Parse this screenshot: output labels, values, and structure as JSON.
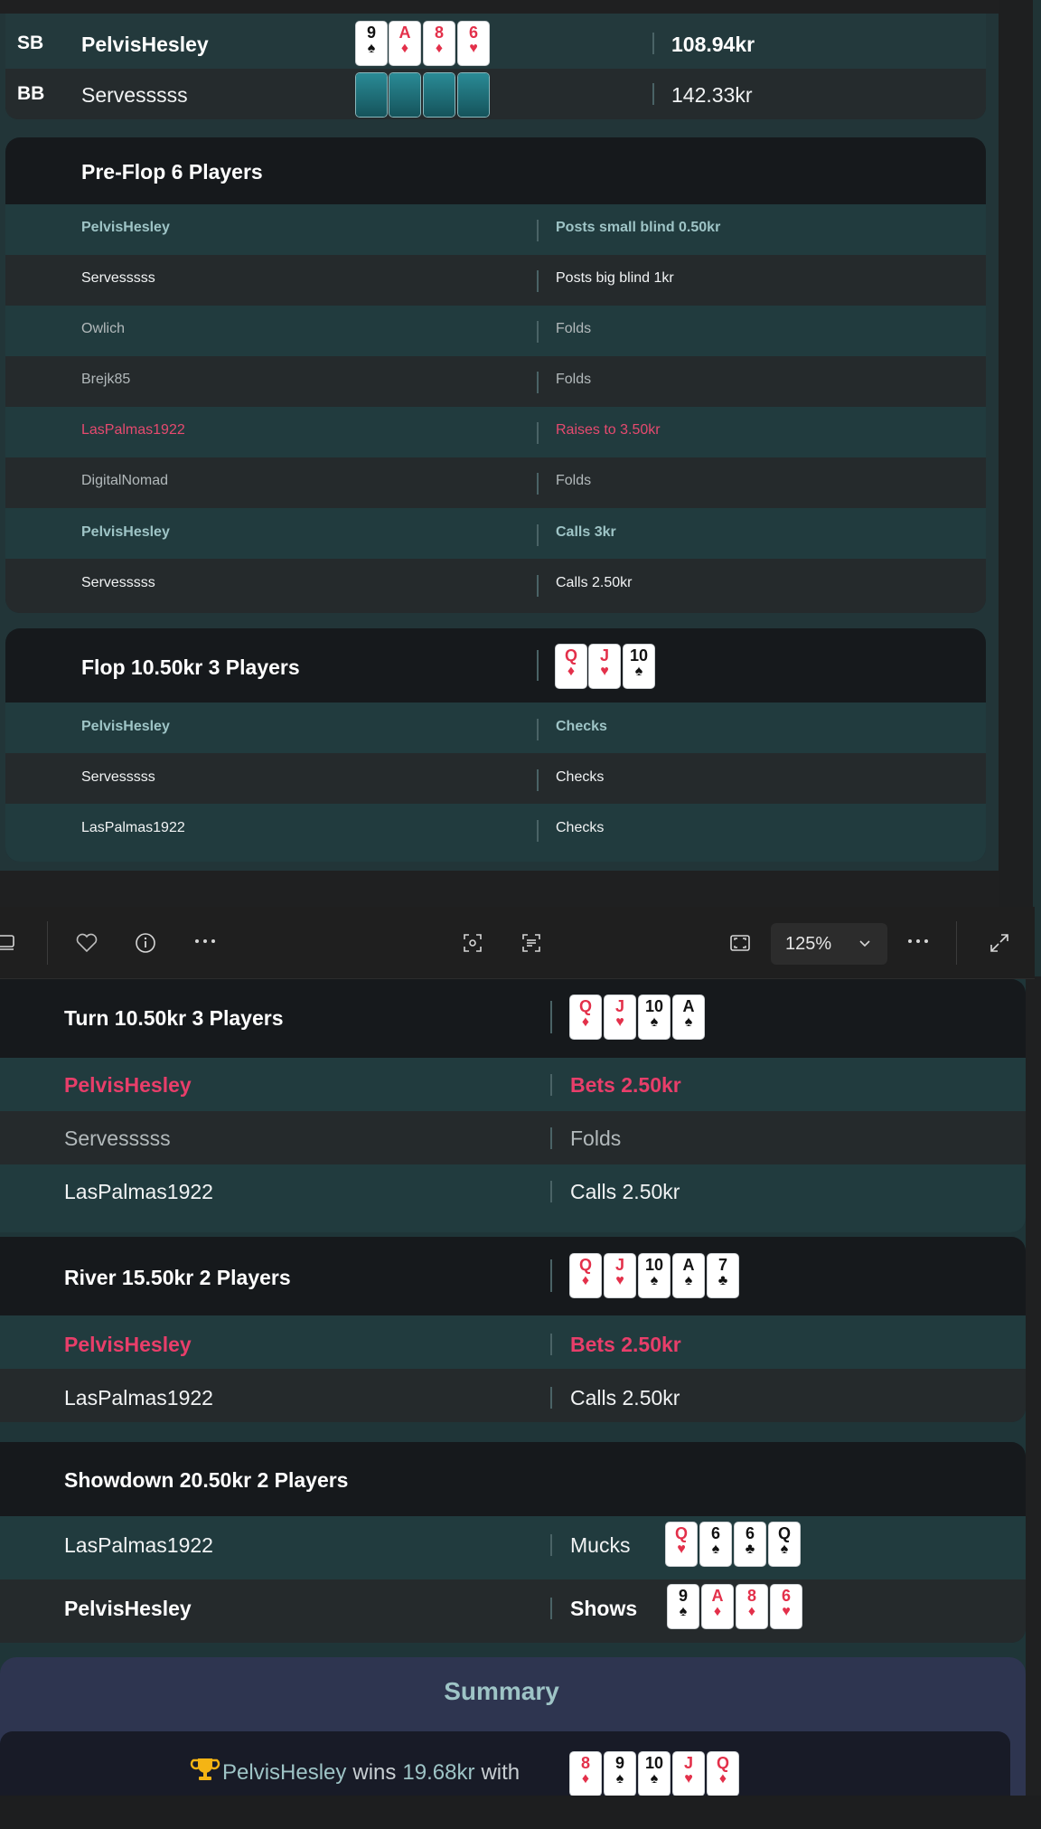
{
  "seats": [
    {
      "pos": "SB",
      "name": "PelvisHesley",
      "cards": [
        {
          "rank": "9",
          "suit": "♠"
        },
        {
          "rank": "A",
          "suit": "♦"
        },
        {
          "rank": "8",
          "suit": "♦"
        },
        {
          "rank": "6",
          "suit": "♥"
        }
      ],
      "stack": "108.94kr"
    },
    {
      "pos": "BB",
      "name": "Servesssss",
      "stack": "142.33kr"
    }
  ],
  "preflop": {
    "title": "Pre-Flop  6 Players",
    "actions": [
      {
        "name": "PelvisHesley",
        "action": "Posts small blind 0.50kr"
      },
      {
        "name": "Servesssss",
        "action": "Posts big blind 1kr"
      },
      {
        "name": "Owlich",
        "action": "Folds"
      },
      {
        "name": "Brejk85",
        "action": "Folds"
      },
      {
        "name": "LasPalmas1922",
        "action": "Raises to 3.50kr"
      },
      {
        "name": "DigitalNomad",
        "action": "Folds"
      },
      {
        "name": "PelvisHesley",
        "action": "Calls 3kr"
      },
      {
        "name": "Servesssss",
        "action": "Calls 2.50kr"
      }
    ]
  },
  "flop": {
    "title": "Flop  10.50kr  3 Players",
    "board": [
      {
        "rank": "Q",
        "suit": "♦"
      },
      {
        "rank": "J",
        "suit": "♥"
      },
      {
        "rank": "10",
        "suit": "♠"
      }
    ],
    "actions": [
      {
        "name": "PelvisHesley",
        "action": "Checks"
      },
      {
        "name": "Servesssss",
        "action": "Checks"
      },
      {
        "name": "LasPalmas1922",
        "action": "Checks"
      }
    ]
  },
  "toolbar": {
    "zoom": "125%",
    "icons": [
      "filmstrip-icon",
      "heart-icon",
      "info-icon",
      "more-icon",
      "visual-search-icon",
      "text-scan-icon",
      "fit-icon",
      "chevron-down-icon",
      "more-icon",
      "expand-icon"
    ]
  },
  "turn": {
    "title": "Turn  10.50kr  3 Players",
    "board": [
      {
        "rank": "Q",
        "suit": "♦"
      },
      {
        "rank": "J",
        "suit": "♥"
      },
      {
        "rank": "10",
        "suit": "♠"
      },
      {
        "rank": "A",
        "suit": "♠"
      }
    ],
    "actions": [
      {
        "name": "PelvisHesley",
        "action": "Bets 2.50kr"
      },
      {
        "name": "Servesssss",
        "action": "Folds"
      },
      {
        "name": "LasPalmas1922",
        "action": "Calls 2.50kr"
      }
    ]
  },
  "river": {
    "title": "River  15.50kr  2 Players",
    "board": [
      {
        "rank": "Q",
        "suit": "♦"
      },
      {
        "rank": "J",
        "suit": "♥"
      },
      {
        "rank": "10",
        "suit": "♠"
      },
      {
        "rank": "A",
        "suit": "♠"
      },
      {
        "rank": "7",
        "suit": "♣"
      }
    ],
    "actions": [
      {
        "name": "PelvisHesley",
        "action": "Bets 2.50kr"
      },
      {
        "name": "LasPalmas1922",
        "action": "Calls 2.50kr"
      }
    ]
  },
  "showdown": {
    "title": "Showdown  20.50kr  2 Players",
    "actions": [
      {
        "name": "LasPalmas1922",
        "action": "Mucks",
        "cards": [
          {
            "rank": "Q",
            "suit": "♥"
          },
          {
            "rank": "6",
            "suit": "♠"
          },
          {
            "rank": "6",
            "suit": "♣"
          },
          {
            "rank": "Q",
            "suit": "♠"
          }
        ]
      },
      {
        "name": "PelvisHesley",
        "action": "Shows",
        "cards": [
          {
            "rank": "9",
            "suit": "♠"
          },
          {
            "rank": "A",
            "suit": "♦"
          },
          {
            "rank": "8",
            "suit": "♦"
          },
          {
            "rank": "6",
            "suit": "♥"
          }
        ]
      }
    ]
  },
  "summary": {
    "title": "Summary",
    "winner": "PelvisHesley",
    "wins": "wins",
    "amount": "19.68kr",
    "with": "with",
    "cards": [
      {
        "rank": "8",
        "suit": "♦"
      },
      {
        "rank": "9",
        "suit": "♠"
      },
      {
        "rank": "10",
        "suit": "♠"
      },
      {
        "rank": "J",
        "suit": "♥"
      },
      {
        "rank": "Q",
        "suit": "♦"
      }
    ]
  }
}
